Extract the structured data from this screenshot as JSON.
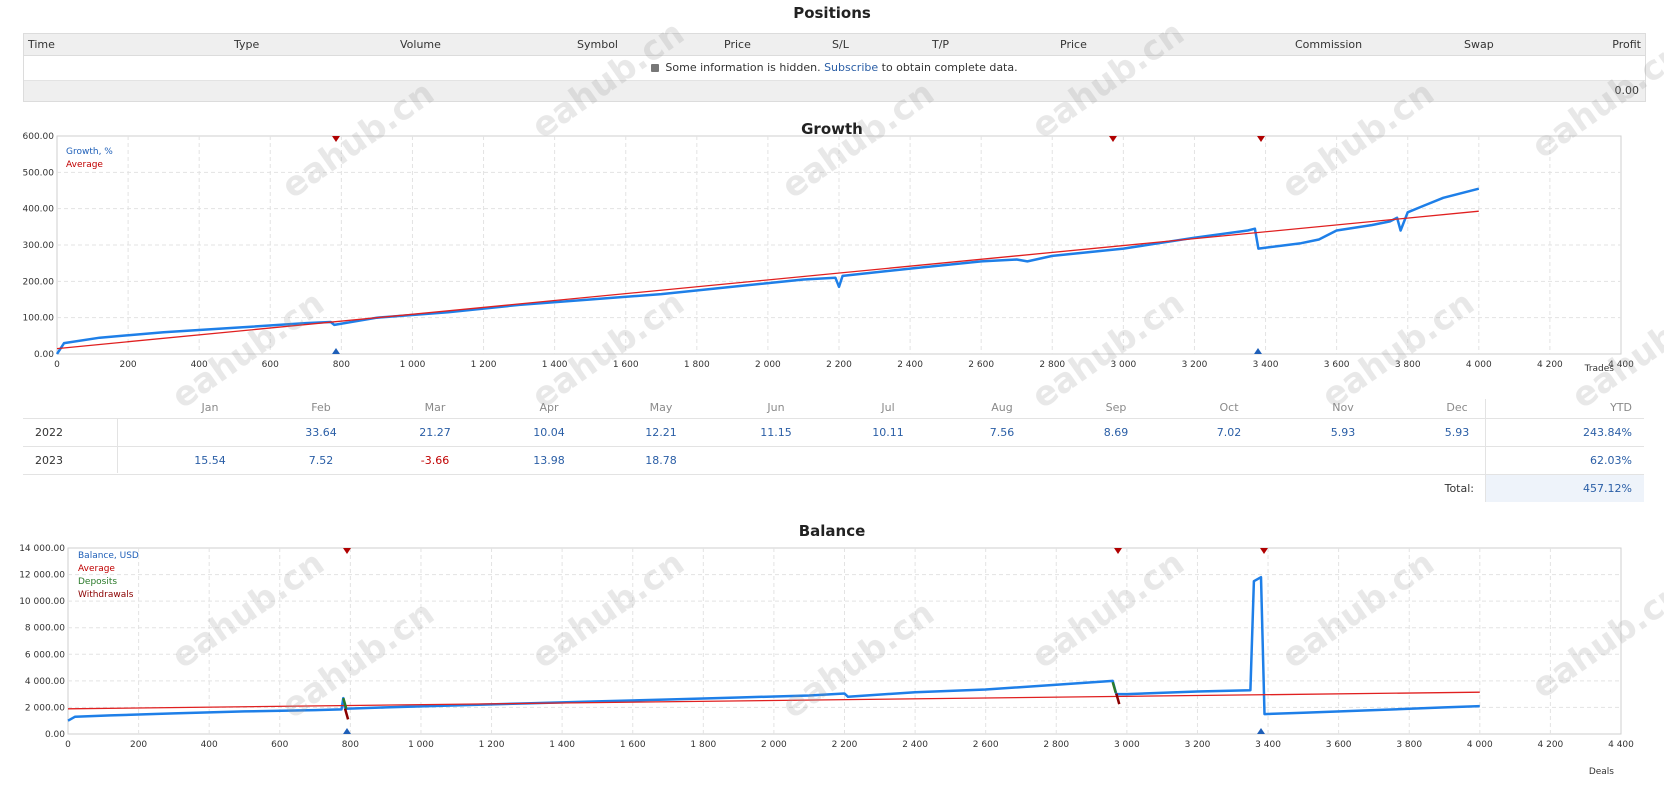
{
  "positions": {
    "title": "Positions",
    "columns": [
      "Time",
      "Type",
      "Volume",
      "Symbol",
      "Price",
      "S/L",
      "T/P",
      "Price",
      "Commission",
      "Swap",
      "Profit"
    ],
    "info_pre": "Some information is hidden.",
    "info_link": "Subscribe",
    "info_post": "to obtain complete data.",
    "total": "0.00"
  },
  "growth": {
    "title": "Growth",
    "legend": [
      "Growth, %",
      "Average"
    ],
    "x_axis_label": "Trades"
  },
  "monthly": {
    "months": [
      "Jan",
      "Feb",
      "Mar",
      "Apr",
      "May",
      "Jun",
      "Jul",
      "Aug",
      "Sep",
      "Oct",
      "Nov",
      "Dec"
    ],
    "ytd_label": "YTD",
    "rows": [
      {
        "year": "2022",
        "values": [
          "",
          "33.64",
          "21.27",
          "10.04",
          "12.21",
          "11.15",
          "10.11",
          "7.56",
          "8.69",
          "7.02",
          "5.93",
          "5.93"
        ],
        "ytd": "243.84%"
      },
      {
        "year": "2023",
        "values": [
          "15.54",
          "7.52",
          "-3.66",
          "13.98",
          "18.78",
          "",
          "",
          "",
          "",
          "",
          "",
          ""
        ],
        "ytd": "62.03%"
      }
    ],
    "total_label": "Total:",
    "total_value": "457.12%"
  },
  "balance": {
    "title": "Balance",
    "legend": [
      "Balance, USD",
      "Average",
      "Deposits",
      "Withdrawals"
    ],
    "x_axis_label": "Deals"
  },
  "watermark_text": "eahub.cn",
  "colors": {
    "series": "#1e7fe8",
    "average": "#e02020",
    "deposits": "#2a7a2a",
    "withdrawals": "#8b0000"
  },
  "chart_data": [
    {
      "type": "line",
      "title": "Growth",
      "xlabel": "Trades",
      "ylabel": "",
      "xlim": [
        0,
        4400
      ],
      "ylim": [
        0,
        600
      ],
      "x_ticks": [
        "0",
        "200",
        "400",
        "600",
        "800",
        "1 000",
        "1 200",
        "1 400",
        "1 600",
        "1 800",
        "2 000",
        "2 200",
        "2 400",
        "2 600",
        "2 800",
        "3 000",
        "3 200",
        "3 400",
        "3 600",
        "3 800",
        "4 000",
        "4 200",
        "4 400"
      ],
      "y_ticks": [
        "0.00",
        "100.00",
        "200.00",
        "300.00",
        "400.00",
        "500.00",
        "600.00"
      ],
      "grid": true,
      "legend_position": "top-left",
      "series": [
        {
          "name": "Growth, %",
          "x": [
            0,
            20,
            120,
            300,
            500,
            700,
            770,
            780,
            900,
            1100,
            1300,
            1500,
            1700,
            1900,
            2100,
            2190,
            2200,
            2210,
            2400,
            2600,
            2700,
            2730,
            2800,
            3000,
            3200,
            3350,
            3370,
            3380,
            3500,
            3550,
            3600,
            3700,
            3750,
            3770,
            3780,
            3800,
            3850,
            3900,
            4000
          ],
          "y": [
            0,
            30,
            45,
            60,
            72,
            85,
            88,
            80,
            100,
            115,
            135,
            150,
            165,
            185,
            205,
            210,
            185,
            215,
            235,
            255,
            260,
            255,
            270,
            290,
            320,
            340,
            345,
            290,
            305,
            315,
            340,
            355,
            365,
            375,
            340,
            390,
            410,
            430,
            455
          ]
        },
        {
          "name": "Average",
          "x": [
            0,
            4000
          ],
          "y": [
            15,
            393
          ]
        }
      ]
    },
    {
      "type": "line",
      "title": "Balance",
      "xlabel": "Deals",
      "ylabel": "",
      "xlim": [
        0,
        4400
      ],
      "ylim": [
        0,
        14000
      ],
      "x_ticks": [
        "0",
        "200",
        "400",
        "600",
        "800",
        "1 000",
        "1 200",
        "1 400",
        "1 600",
        "1 800",
        "2 000",
        "2 200",
        "2 400",
        "2 600",
        "2 800",
        "3 000",
        "3 200",
        "3 400",
        "3 600",
        "3 800",
        "4 000",
        "4 200",
        "4 400"
      ],
      "y_ticks": [
        "0.00",
        "2 000.00",
        "4 000.00",
        "6 000.00",
        "8 000.00",
        "10 000.00",
        "12 000.00",
        "14 000.00"
      ],
      "grid": true,
      "legend_position": "top-left",
      "series": [
        {
          "name": "Balance, USD",
          "x": [
            0,
            20,
            120,
            300,
            500,
            700,
            775,
            780,
            785,
            900,
            1100,
            1300,
            1500,
            1700,
            1900,
            2100,
            2200,
            2210,
            2400,
            2600,
            2800,
            2960,
            2970,
            3000,
            3200,
            3350,
            3360,
            3380,
            3390,
            3500,
            3700,
            3800,
            3900,
            4000
          ],
          "y": [
            1000,
            1300,
            1400,
            1550,
            1700,
            1800,
            1850,
            2700,
            1900,
            2000,
            2150,
            2300,
            2450,
            2600,
            2750,
            2900,
            3050,
            2800,
            3150,
            3350,
            3700,
            4000,
            3000,
            3000,
            3200,
            3300,
            11500,
            11800,
            1500,
            1600,
            1800,
            1900,
            2000,
            2100
          ]
        },
        {
          "name": "Average",
          "x": [
            0,
            4000
          ],
          "y": [
            1900,
            3150
          ]
        },
        {
          "name": "Deposits",
          "x": [
            780,
            2960
          ],
          "y": [
            2700,
            3900
          ]
        },
        {
          "name": "Withdrawals",
          "x": [
            785,
            2970
          ],
          "y": [
            1900,
            3050
          ]
        }
      ]
    }
  ]
}
